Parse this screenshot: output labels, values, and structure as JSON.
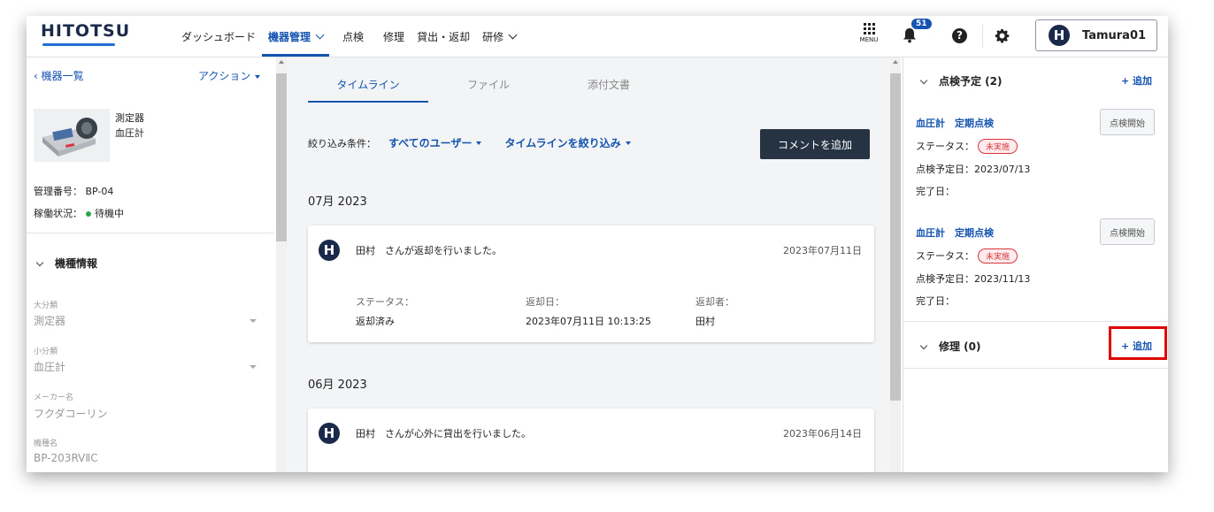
{
  "header": {
    "logo": "HITOTSU",
    "nav": [
      {
        "label": "ダッシュボード",
        "active": false,
        "has_dropdown": false
      },
      {
        "label": "機器管理",
        "active": true,
        "has_dropdown": true
      },
      {
        "label": "点検",
        "active": false,
        "has_dropdown": false
      },
      {
        "label": "修理",
        "active": false,
        "has_dropdown": false
      },
      {
        "label": "貸出・返却",
        "active": false,
        "has_dropdown": false
      },
      {
        "label": "研修",
        "active": false,
        "has_dropdown": true
      }
    ],
    "menu_label": "MENU",
    "notification_count": "51",
    "help_symbol": "?",
    "user": {
      "initial": "H",
      "name": "Tamura01"
    }
  },
  "left": {
    "back_link": "機器一覧",
    "action_label": "アクション",
    "device_category": "測定器",
    "device_type": "血圧計",
    "management_label": "管理番号：",
    "management_value": "BP-04",
    "status_label": "稼働状況：",
    "status_value": "待機中",
    "section_title": "機種情報",
    "fields": [
      {
        "label": "大分類",
        "value": "測定器",
        "select": true
      },
      {
        "label": "小分類",
        "value": "血圧計",
        "select": true
      },
      {
        "label": "メーカー名",
        "value": "フクダコーリン",
        "select": false
      },
      {
        "label": "機種名",
        "value": "BP-203RVⅡC",
        "select": false
      }
    ]
  },
  "center": {
    "tabs": [
      "タイムライン",
      "ファイル",
      "添付文書"
    ],
    "filter_label": "絞り込み条件：",
    "filter_users": "すべてのユーザー",
    "filter_timeline": "タイムラインを絞り込み",
    "comment_button": "コメントを追加",
    "groups": [
      {
        "month": "07月 2023",
        "entry": {
          "initial": "H",
          "title": "田村　さんが返却を行いました。",
          "date": "2023年07月11日",
          "columns": [
            {
              "label": "ステータス：",
              "value": "返却済み"
            },
            {
              "label": "返却日：",
              "value": "2023年07月11日 10:13:25"
            },
            {
              "label": "返却者：",
              "value": "田村"
            }
          ]
        }
      },
      {
        "month": "06月 2023",
        "entry": {
          "initial": "H",
          "title": "田村　さんが心外に貸出を行いました。",
          "date": "2023年06月14日",
          "columns": []
        }
      }
    ]
  },
  "right": {
    "inspection_header": "点検予定 (2)",
    "add_label": "+ 追加",
    "inspections": [
      {
        "title": "血圧計　定期点検",
        "status_label": "ステータス：",
        "status": "未実施",
        "scheduled": "点検予定日：2023/07/13",
        "completed": "完了日：",
        "start_button": "点検開始"
      },
      {
        "title": "血圧計　定期点検",
        "status_label": "ステータス：",
        "status": "未実施",
        "scheduled": "点検予定日：2023/11/13",
        "completed": "完了日：",
        "start_button": "点検開始"
      }
    ],
    "repair_header": "修理 (0)",
    "repair_add_label": "+ 追加"
  },
  "colors": {
    "primary": "#1554b0",
    "dark_button": "#253343",
    "status_red": "#d9363e",
    "status_green": "#2aa845",
    "highlight_red": "#e00000"
  }
}
